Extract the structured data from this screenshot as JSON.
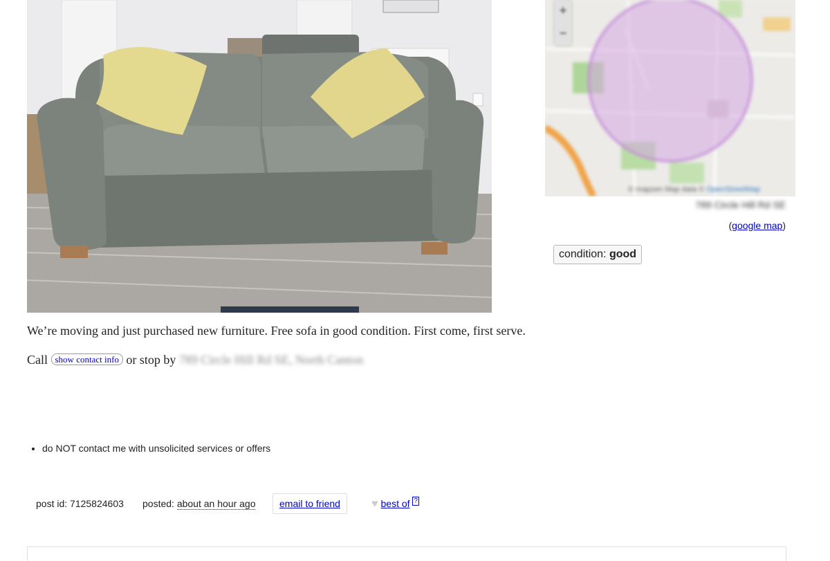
{
  "posting": {
    "description": "We’re moving and just purchased new furniture. Free sofa in good condition. First come, first serve.",
    "call_prefix": "Call",
    "contact_button": "show contact info",
    "stop_by": "or stop by",
    "stop_by_address": "789 Circle Hill Rd SE, North Canton"
  },
  "map": {
    "attribution_prefix": "© mapzen   Map data ©",
    "attribution_link": "OpenStreetMap",
    "address": "789 Circle Hill Rd SE",
    "google_map_open": "(",
    "google_map_label": "google map",
    "google_map_close": ")",
    "zoom_in": "+",
    "zoom_out": "−"
  },
  "attributes": {
    "condition_label": "condition:",
    "condition_value": "good"
  },
  "notices": [
    "do NOT contact me with unsolicited services or offers"
  ],
  "postinginfo": {
    "post_id_label": "post id: 7125824603",
    "posted_label": "posted:",
    "posted_time": "about an hour ago",
    "email_label": "email to friend",
    "best_of_label": "best of",
    "best_of_help": "?"
  },
  "colors": {
    "link": "#0000cc",
    "map_circle": "#c48bd8",
    "sofa": "#7f8680",
    "pillow": "#e2d98f"
  },
  "icons": {
    "heart": "heart-icon"
  }
}
